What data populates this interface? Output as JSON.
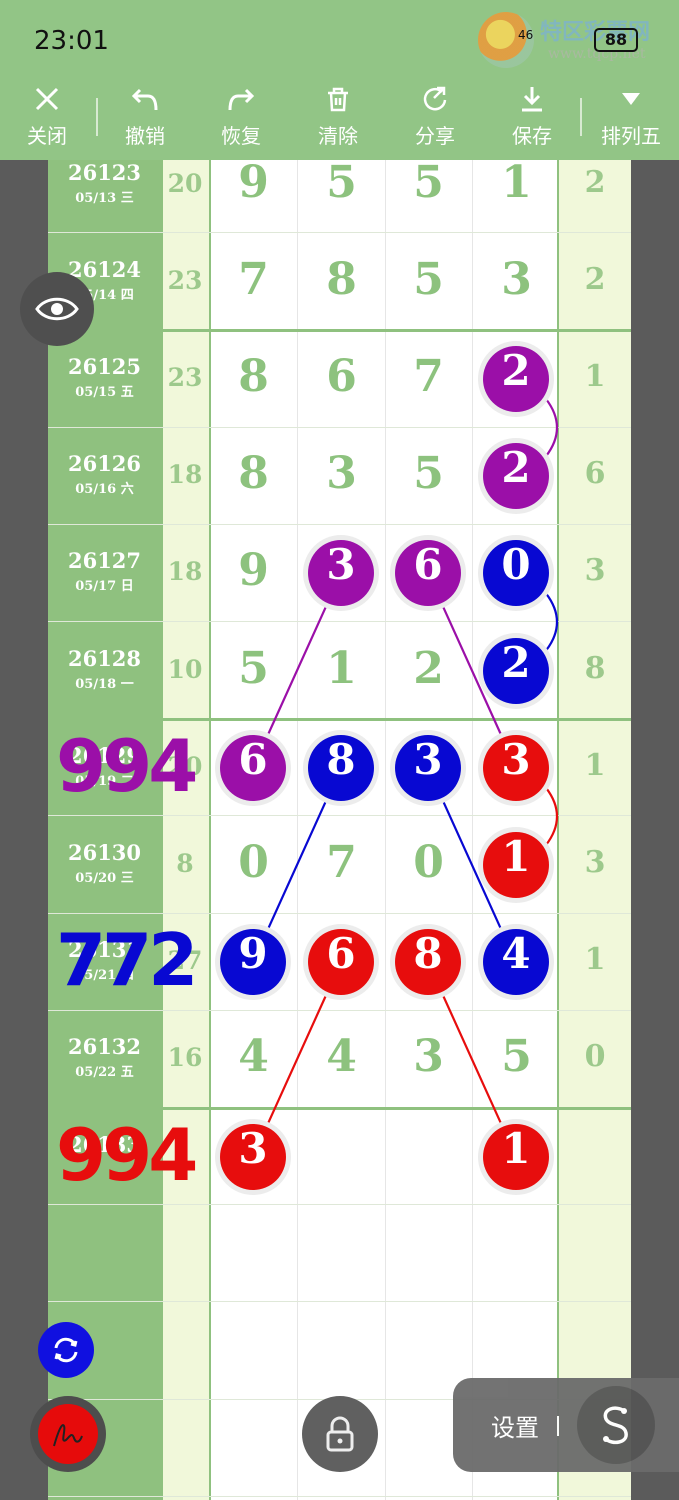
{
  "status": {
    "time": "23:01",
    "battery": "88",
    "signal": "46"
  },
  "watermark": {
    "brand": "特区彩票网",
    "url": "www.tqcp.net"
  },
  "toolbar": {
    "close": "关闭",
    "undo": "撤销",
    "redo": "恢复",
    "clear": "清除",
    "share": "分享",
    "save": "保存",
    "mode": "排列五"
  },
  "rows": [
    {
      "issue": "26123",
      "date": "05/13 三",
      "sum": "20",
      "digits": [
        "9",
        "5",
        "5",
        "1"
      ],
      "extra": "2"
    },
    {
      "issue": "26124",
      "date": "05/14 四",
      "sum": "23",
      "digits": [
        "7",
        "8",
        "5",
        "3"
      ],
      "extra": "2"
    },
    {
      "issue": "26125",
      "date": "05/15 五",
      "sum": "23",
      "digits": [
        "8",
        "6",
        "7",
        "2"
      ],
      "extra": "1"
    },
    {
      "issue": "26126",
      "date": "05/16 六",
      "sum": "18",
      "digits": [
        "8",
        "3",
        "5",
        "2"
      ],
      "extra": "6"
    },
    {
      "issue": "26127",
      "date": "05/17 日",
      "sum": "18",
      "digits": [
        "9",
        "3",
        "6",
        "0"
      ],
      "extra": "3"
    },
    {
      "issue": "26128",
      "date": "05/18 一",
      "sum": "10",
      "digits": [
        "5",
        "1",
        "2",
        "2"
      ],
      "extra": "8"
    },
    {
      "issue": "26129",
      "date": "05/19 二",
      "sum": "20",
      "digits": [
        "6",
        "8",
        "3",
        "3"
      ],
      "extra": "1"
    },
    {
      "issue": "26130",
      "date": "05/20 三",
      "sum": "8",
      "digits": [
        "0",
        "7",
        "0",
        "1"
      ],
      "extra": "3"
    },
    {
      "issue": "26131",
      "date": "05/21 四",
      "sum": "27",
      "digits": [
        "9",
        "6",
        "8",
        "4"
      ],
      "extra": "1"
    },
    {
      "issue": "26132",
      "date": "05/22 五",
      "sum": "16",
      "digits": [
        "4",
        "4",
        "3",
        "5"
      ],
      "extra": "0"
    },
    {
      "issue": "26133",
      "date": "",
      "sum": "",
      "digits": [
        "3",
        "",
        "",
        "1"
      ],
      "extra": ""
    }
  ],
  "annotations": [
    {
      "text": "994",
      "color": "#9b0fa8"
    },
    {
      "text": "772",
      "color": "#0808d2"
    },
    {
      "text": "994",
      "color": "#e70d0d"
    }
  ],
  "colors": {
    "purple": "#9b0fa8",
    "blue": "#0808d2",
    "red": "#e70d0d",
    "grid_green": "#8fc17f"
  },
  "controls": {
    "settings": "设置"
  }
}
